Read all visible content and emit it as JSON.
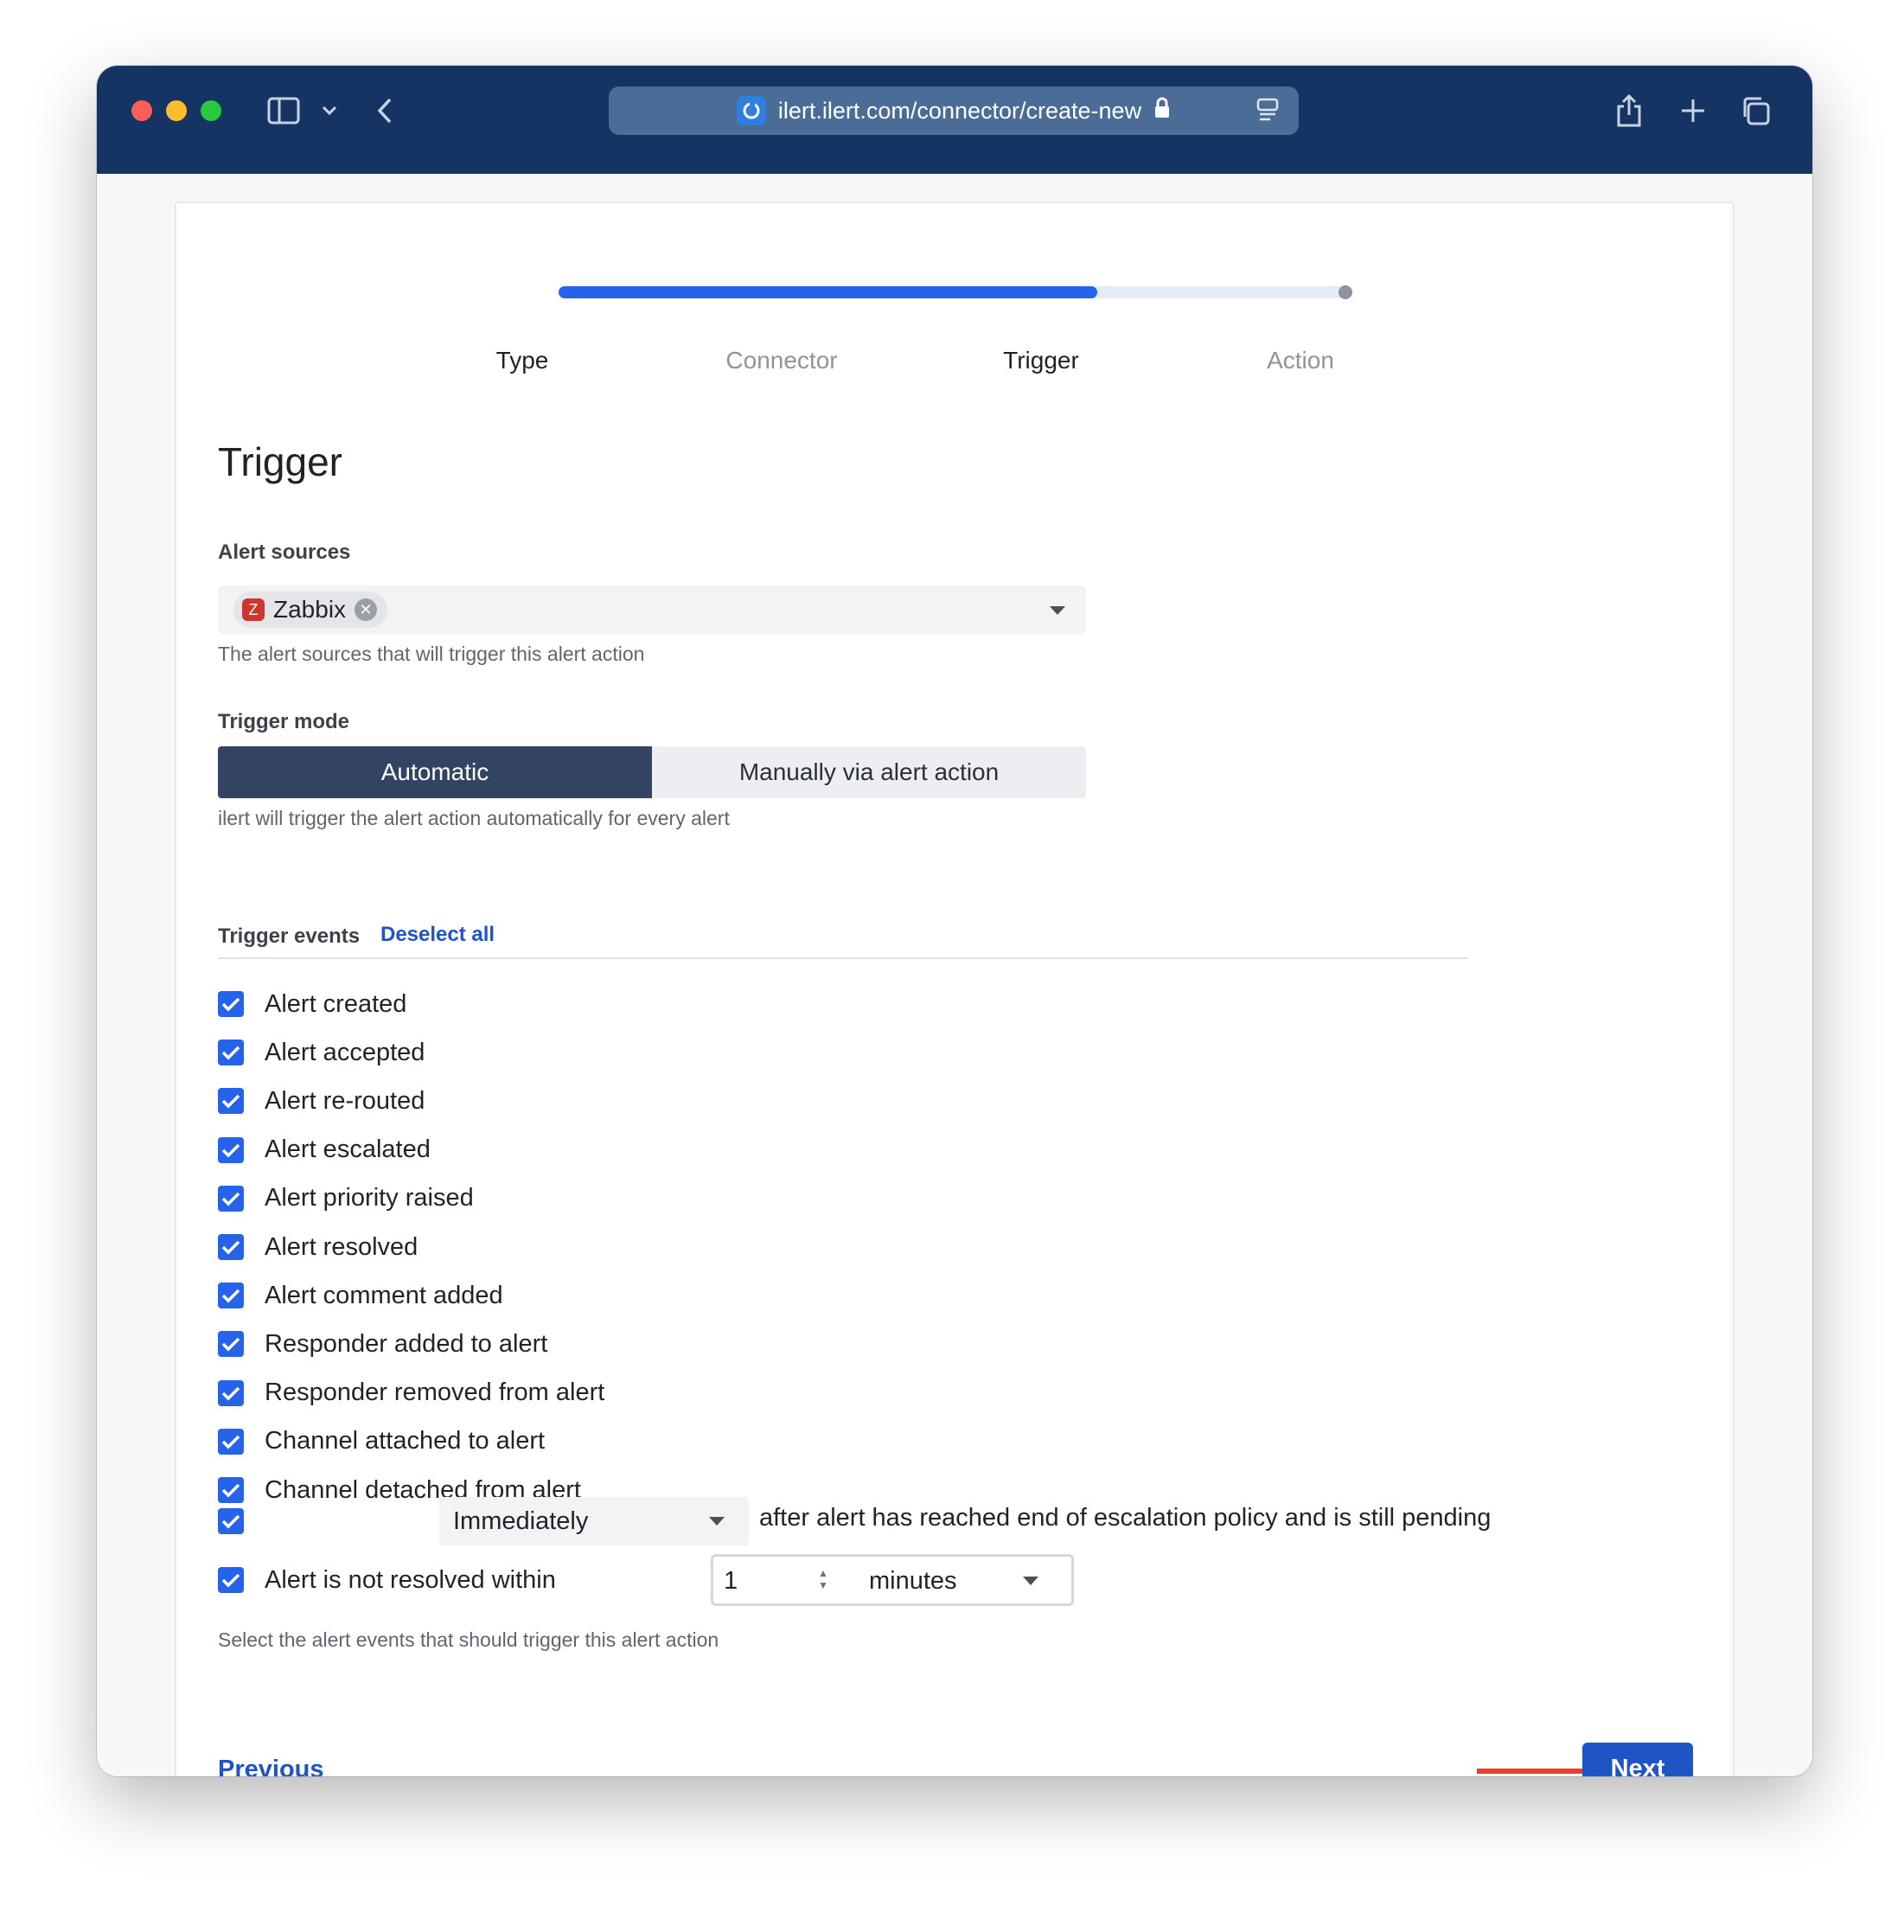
{
  "browser": {
    "url": "ilert.ilert.com/connector/create-new"
  },
  "stepper": {
    "progress_fraction": 0.68,
    "steps": [
      {
        "label": "Type",
        "state": "active"
      },
      {
        "label": "Connector",
        "state": "inactive"
      },
      {
        "label": "Trigger",
        "state": "active"
      },
      {
        "label": "Action",
        "state": "inactive"
      }
    ]
  },
  "page": {
    "title": "Trigger"
  },
  "alert_sources": {
    "label": "Alert sources",
    "selected_chip": "Zabbix",
    "chip_icon_letter": "Z",
    "help": "The alert sources that will trigger this alert action"
  },
  "trigger_mode": {
    "label": "Trigger mode",
    "options": [
      "Automatic",
      "Manually via alert action"
    ],
    "selected": "Automatic",
    "help": "ilert will trigger the alert action automatically for every alert"
  },
  "trigger_events": {
    "label": "Trigger events",
    "deselect_all": "Deselect all",
    "events": [
      "Alert created",
      "Alert accepted",
      "Alert re-routed",
      "Alert escalated",
      "Alert priority raised",
      "Alert resolved",
      "Alert comment added",
      "Responder added to alert",
      "Responder removed from alert",
      "Channel attached to alert",
      "Channel detached from alert"
    ],
    "escalation_select": "Immediately",
    "escalation_text": "after alert has reached end of escalation policy and is still pending",
    "not_resolved_label": "Alert is not resolved within",
    "not_resolved_value": "1",
    "not_resolved_unit": "minutes",
    "help": "Select the alert events that should trigger this alert action"
  },
  "footer": {
    "previous": "Previous",
    "next": "Next"
  },
  "colors": {
    "accent": "#2563eb",
    "link": "#1f54c6",
    "titlebar": "#163463",
    "segment_active": "#334463",
    "annotation_arrow": "#e8402a"
  }
}
